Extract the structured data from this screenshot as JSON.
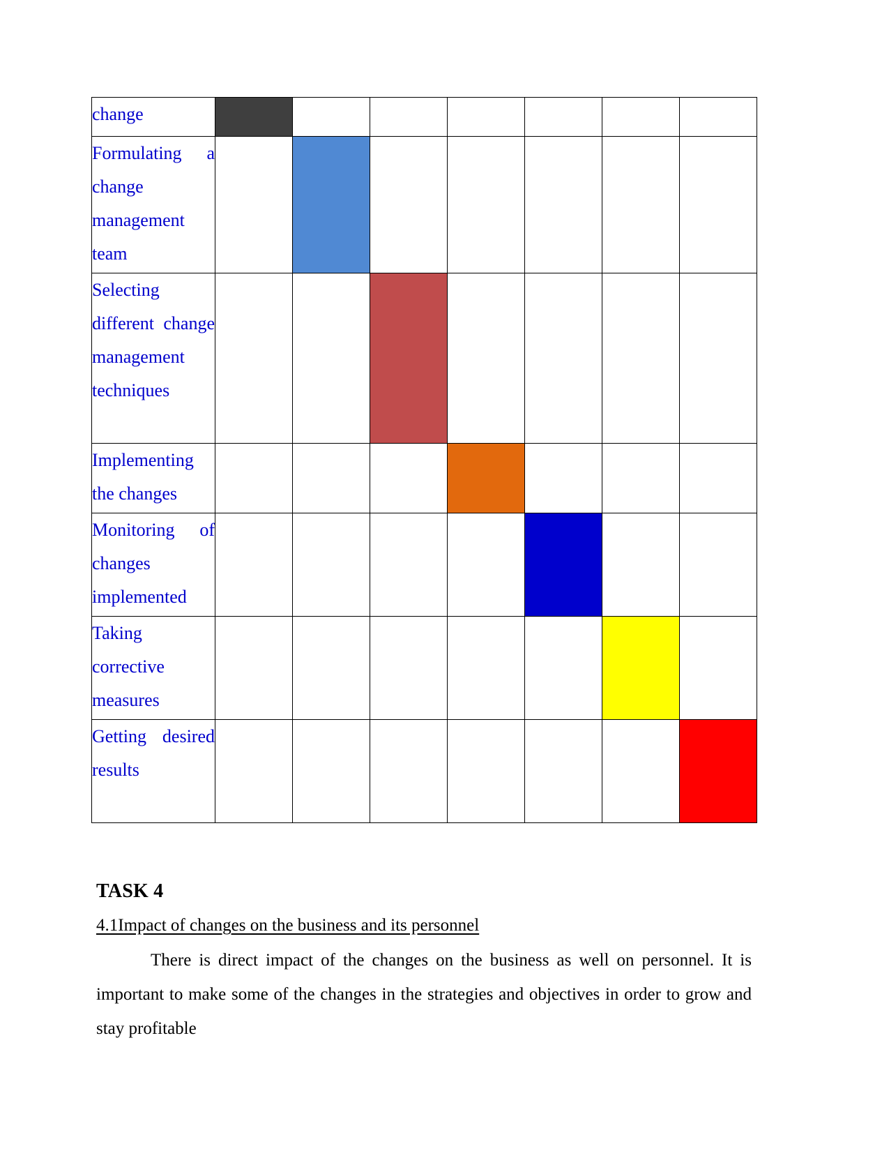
{
  "document": {
    "page_background": "#ffffff",
    "label_text_color": "#0000CC",
    "body_text_color": "#000000",
    "grid_line_color": "#000000"
  },
  "gantt": {
    "columns": 7,
    "rows": [
      {
        "label": "change",
        "bar_column": 1,
        "bar_color": "#3F3F3F",
        "color_name": "dark-gray"
      },
      {
        "label": "Formulating a change management team",
        "bar_column": 2,
        "bar_color": "#5089D3",
        "color_name": "light-blue"
      },
      {
        "label": "Selecting different change management techniques",
        "bar_column": 3,
        "bar_color": "#C04C4C",
        "color_name": "brick-red"
      },
      {
        "label": "Implementing the changes",
        "bar_column": 4,
        "bar_color": "#E2690D",
        "color_name": "orange"
      },
      {
        "label": "Monitoring of changes implemented",
        "bar_column": 5,
        "bar_color": "#0000CC",
        "color_name": "dark-blue"
      },
      {
        "label": "Taking corrective measures",
        "bar_column": 6,
        "bar_color": "#FFFF00",
        "color_name": "yellow"
      },
      {
        "label": "Getting desired results",
        "bar_column": 7,
        "bar_color": "#FF0000",
        "color_name": "red"
      }
    ]
  },
  "content": {
    "task_heading": "TASK 4",
    "sub_heading": "4.1Impact of changes on the business and its personnel",
    "paragraph": "There is direct impact of the changes on the business as well on personnel. It is important to make some of the changes in the strategies and objectives in order to grow and stay profitable"
  }
}
